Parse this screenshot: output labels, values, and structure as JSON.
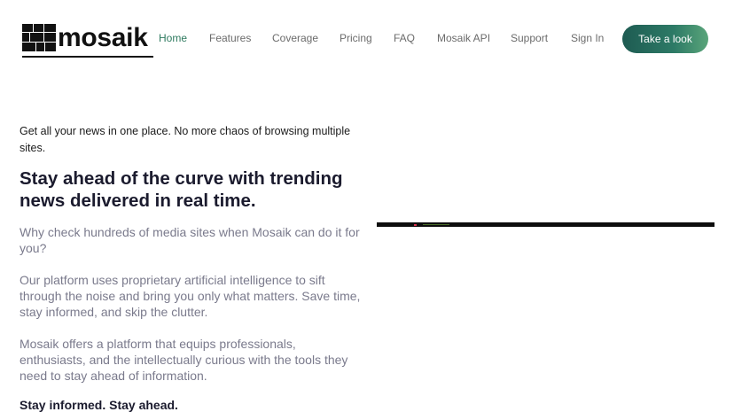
{
  "brand": {
    "name": "mosaik"
  },
  "nav": {
    "items": [
      {
        "label": "Home",
        "active": true
      },
      {
        "label": "Features",
        "active": false
      },
      {
        "label": "Coverage",
        "active": false
      },
      {
        "label": "Pricing",
        "active": false
      },
      {
        "label": "FAQ",
        "active": false
      },
      {
        "label": "Mosaik API",
        "active": false
      },
      {
        "label": "Support",
        "active": false
      },
      {
        "label": "Sign In",
        "active": false
      }
    ],
    "cta_label": "Take a look"
  },
  "hero": {
    "intro": "Get all your news in one place. No more chaos of browsing multiple sites.",
    "headline": "Stay ahead of the curve with trending news delivered in real time.",
    "paragraphs": [
      "Why check hundreds of media sites when Mosaik can do it for you?",
      "Our platform uses proprietary artificial intelligence to sift through the noise and bring you only what matters. Save time, stay informed, and skip the clutter.",
      "Mosaik offers a platform that equips professionals, enthusiasts, and the intellectually curious with the tools they need to stay ahead of information."
    ],
    "tagline": "Stay informed. Stay ahead."
  },
  "colors": {
    "accent": "#2e7a5f",
    "cta_gradient_start": "#1e5b52",
    "cta_gradient_end": "#5aa57a",
    "heading": "#1b1b2e",
    "body_muted": "#7a7a8c"
  },
  "icons": {
    "logo": "mosaic-tiles-icon"
  }
}
